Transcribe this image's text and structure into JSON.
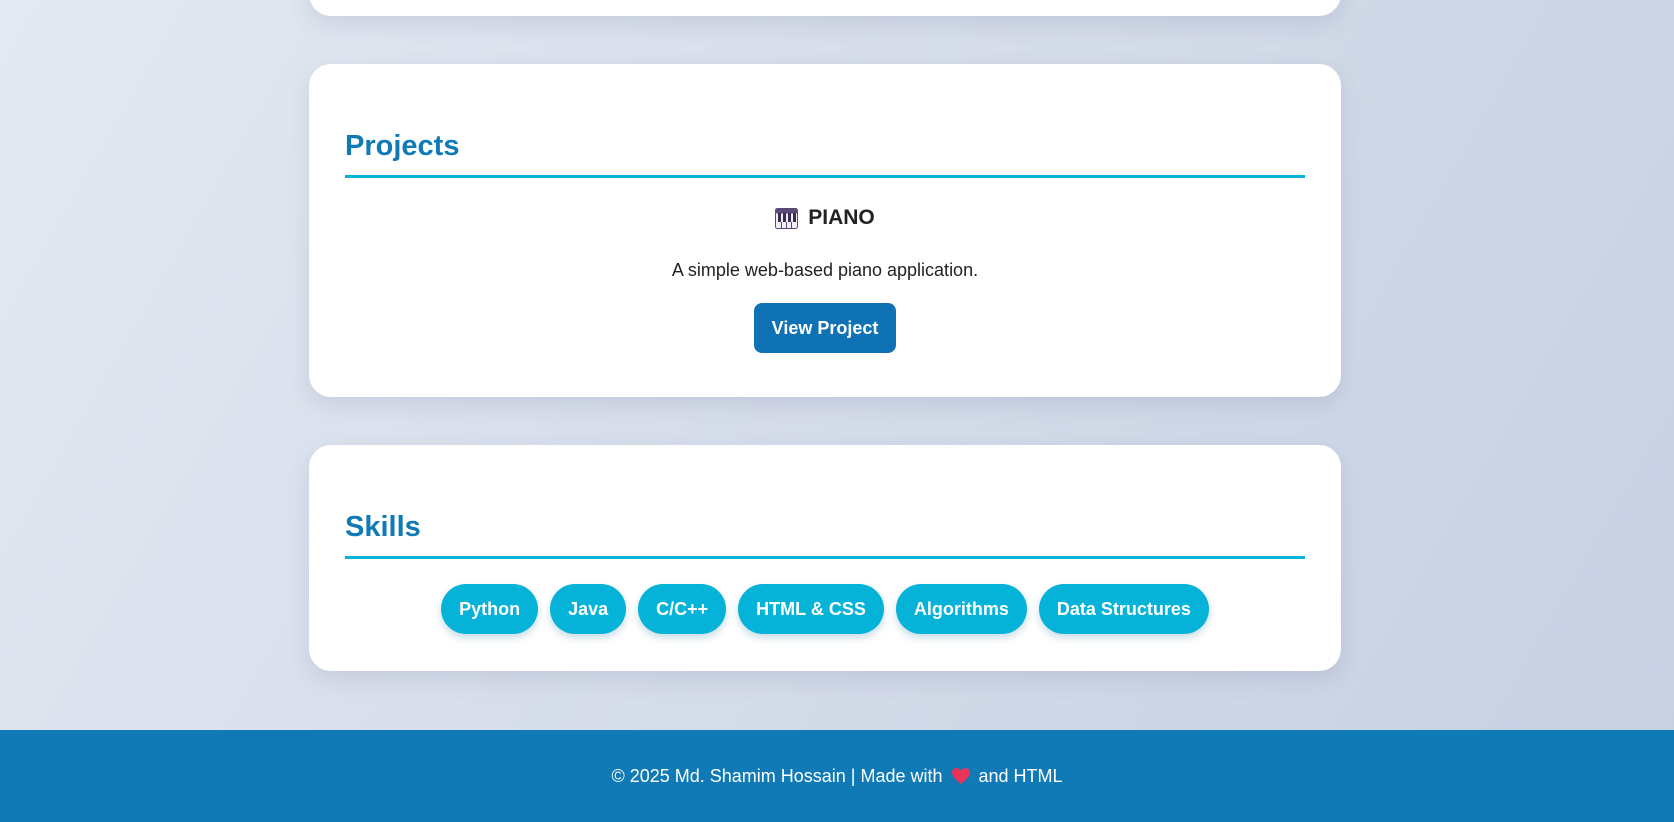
{
  "projects": {
    "heading": "Projects",
    "items": [
      {
        "icon": "piano-icon",
        "title": "PIANO",
        "description": "A simple web-based piano application.",
        "button_label": "View Project"
      }
    ]
  },
  "skills": {
    "heading": "Skills",
    "items": [
      "Python",
      "Java",
      "C/C++",
      "HTML & CSS",
      "Algorithms",
      "Data Structures"
    ]
  },
  "footer": {
    "prefix": "© 2025 Md. Shamim Hossain | Made with",
    "icon": "heart-icon",
    "suffix": "and HTML"
  },
  "colors": {
    "accent": "#0f7ab5",
    "chip": "#06b3d8",
    "button": "#0f72b5",
    "heart": "#e8335a"
  }
}
